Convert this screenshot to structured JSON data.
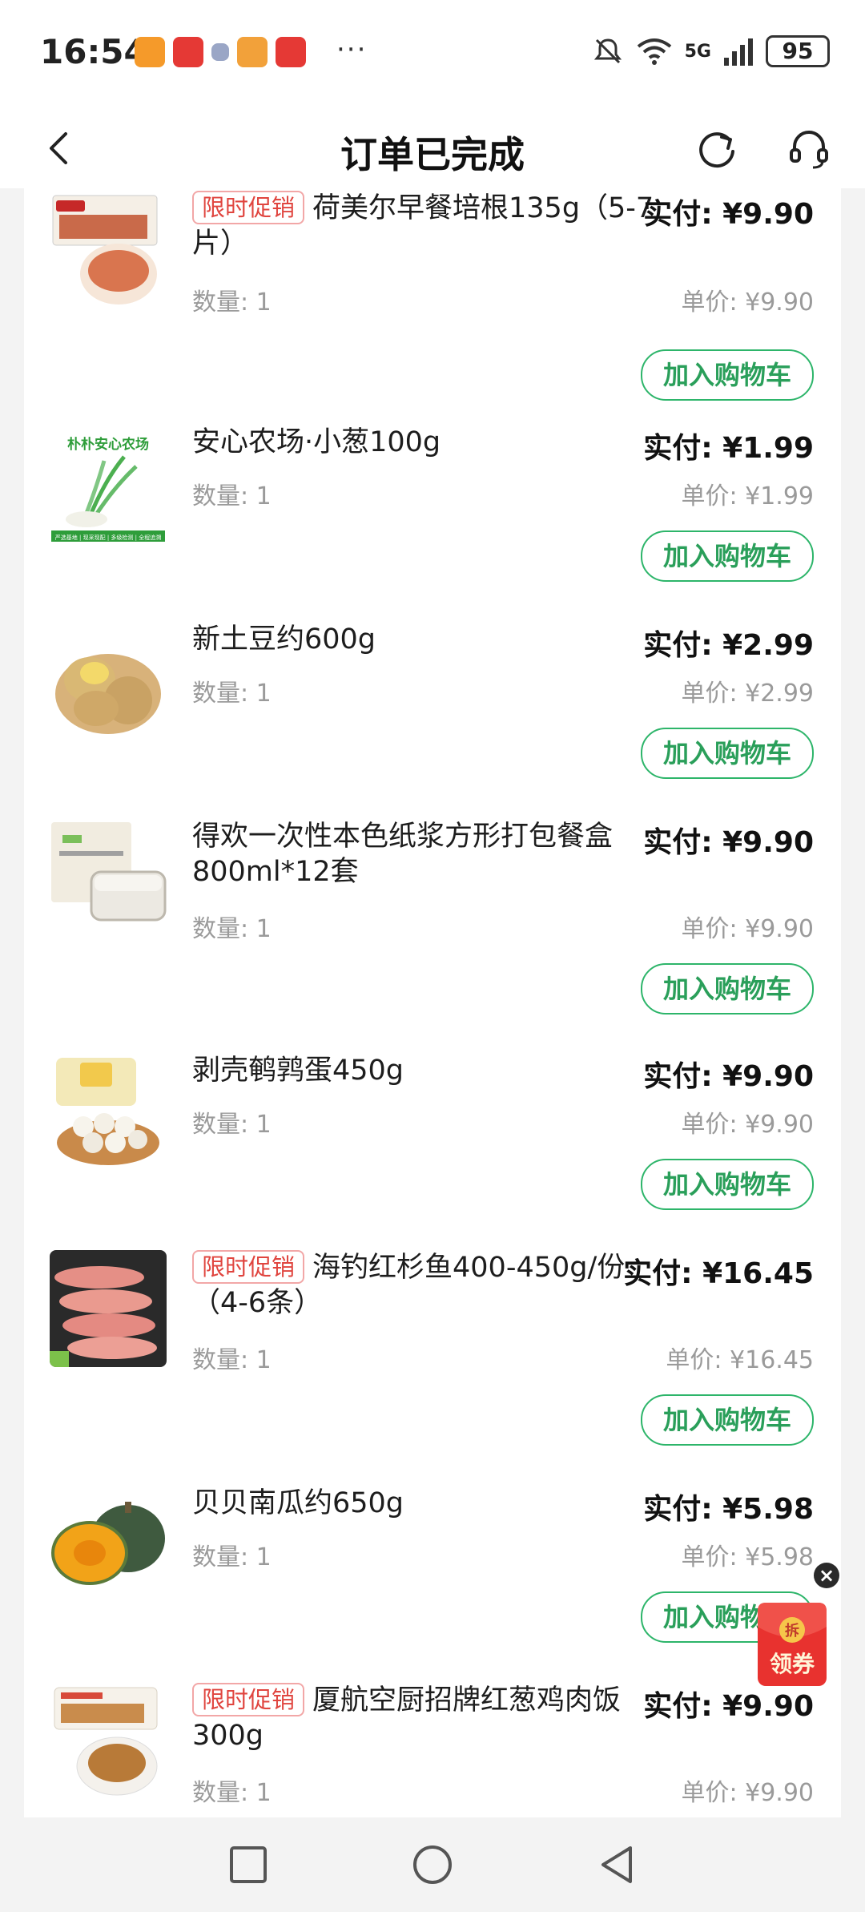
{
  "status_bar": {
    "time": "16:54",
    "more": "···",
    "net": "5G",
    "battery": "95"
  },
  "header": {
    "title": "订单已完成"
  },
  "items": [
    {
      "promo": "限时促销",
      "name": "荷美尔早餐培根135g（5-7片）",
      "paid": "实付: ¥9.90",
      "qty": "数量: 1",
      "unit_price": "单价: ¥9.90",
      "button": "加入购物车"
    },
    {
      "promo": "",
      "name": "安心农场·小葱100g",
      "paid": "实付: ¥1.99",
      "qty": "数量: 1",
      "unit_price": "单价: ¥1.99",
      "button": "加入购物车",
      "image_text": "朴朴安心农场",
      "image_subtext": "严选基地 | 现采现配 | 多级检测 | 全程追溯"
    },
    {
      "promo": "",
      "name": "新土豆约600g",
      "paid": "实付: ¥2.99",
      "qty": "数量: 1",
      "unit_price": "单价: ¥2.99",
      "button": "加入购物车"
    },
    {
      "promo": "",
      "name": "得欢一次性本色纸浆方形打包餐盒800ml*12套",
      "paid": "实付: ¥9.90",
      "qty": "数量: 1",
      "unit_price": "单价: ¥9.90",
      "button": "加入购物车"
    },
    {
      "promo": "",
      "name": "剥壳鹌鹑蛋450g",
      "paid": "实付: ¥9.90",
      "qty": "数量: 1",
      "unit_price": "单价: ¥9.90",
      "button": "加入购物车"
    },
    {
      "promo": "限时促销",
      "name": "海钓红杉鱼400-450g/份（4-6条）",
      "paid": "实付: ¥16.45",
      "qty": "数量: 1",
      "unit_price": "单价: ¥16.45",
      "button": "加入购物车"
    },
    {
      "promo": "",
      "name": "贝贝南瓜约650g",
      "paid": "实付: ¥5.98",
      "qty": "数量: 1",
      "unit_price": "单价: ¥5.98",
      "button": "加入购物车"
    },
    {
      "promo": "限时促销",
      "name": "厦航空厨招牌红葱鸡肉饭300g",
      "paid": "实付: ¥9.90",
      "qty": "数量: 1",
      "unit_price": "单价: ¥9.90"
    }
  ],
  "coupon": {
    "top_text": "拆",
    "label": "领券",
    "close": "×"
  },
  "colors": {
    "accent_green": "#2db56a",
    "promo_red": "#e0453f",
    "coupon_red": "#e8322f"
  },
  "icons": [
    "back-arrow-icon",
    "refresh-icon",
    "customer-service-icon",
    "square-nav-icon",
    "circle-nav-icon",
    "triangle-back-nav-icon"
  ]
}
